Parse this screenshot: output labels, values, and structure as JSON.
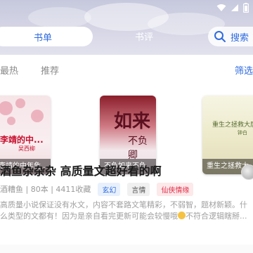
{
  "tabs": {
    "book_list": "书单",
    "review": "书评",
    "search": "搜索"
  },
  "filters": {
    "hot": "最热",
    "recommend": "推荐",
    "filter": "筛选"
  },
  "books": [
    {
      "caption": "李靖的中年危...",
      "cover_title": "李靖的中...",
      "cover_author": "吴西柳"
    },
    {
      "caption": "不负如来不负...",
      "cover_big": "如来",
      "cover_small": "不负卿"
    },
    {
      "caption": "重生之拯救大...",
      "cover_title": "重生之拯救大唐计划",
      "cover_author": "钟白"
    }
  ],
  "post": {
    "title": "酒鱼杂杂杂 高质量文超好看的啊",
    "meta": "酒糟鱼 | 80本 | 4411收藏",
    "tags": [
      "玄幻",
      "言情",
      "仙侠情缘"
    ],
    "excerpt_line1": "高质量小说保证没有水文，内容不套路文笔精彩，不弱智，题材新颖。什",
    "excerpt_line2_a": "么类型的文都有！因为是亲自看完更新可能会较慢哦",
    "excerpt_line2_b": "不符合逻辑瞎掰..."
  },
  "colors": {
    "accent": "#2f6be0",
    "tag_red": "#e0334a"
  }
}
